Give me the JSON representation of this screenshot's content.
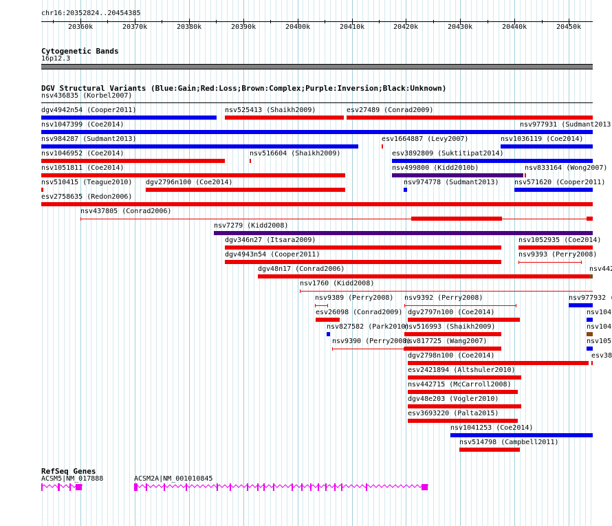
{
  "colors": {
    "gain": "#0000ee",
    "loss": "#ee0000",
    "inversion": "#4b0082",
    "complex": "#8b4513",
    "gene": "#ee00ee",
    "grid_major": "#9fd0dc",
    "grid_minor": "#d5e9ee"
  },
  "ruler": {
    "position": "chr16:20352824..20454385",
    "ticks": [
      "20360k",
      "20370k",
      "20380k",
      "20390k",
      "20400k",
      "20410k",
      "20420k",
      "20430k",
      "20440k",
      "20450k"
    ]
  },
  "cytoband": {
    "title": "Cytogenetic Bands",
    "band_label": "16p12.3"
  },
  "dgv": {
    "title": "DGV Structural Variants (Blue:Gain;Red:Loss;Brown:Complex;Purple:Inversion;Black:Unknown)",
    "features": [
      {
        "label": "nsv436835 (Korbel2007)",
        "type": "none",
        "start": 20352824,
        "end": 20454385,
        "row": 0
      },
      {
        "label": "dgv4942n54 (Cooper2011)",
        "type": "gain",
        "start": 20352824,
        "end": 20385100,
        "row": 1
      },
      {
        "label": "nsv525413 (Shaikh2009)",
        "type": "loss",
        "start": 20386650,
        "end": 20408600,
        "row": 1
      },
      {
        "label": "esv27489 (Conrad2009)",
        "type": "loss",
        "start": 20409100,
        "end": 20454385,
        "row": 1
      },
      {
        "label": "nsv1047399 (Coe2014)",
        "type": "gain",
        "start": 20352824,
        "end": 20440950,
        "row": 2
      },
      {
        "label": "nsv977931 (Sudmant2013)",
        "type": "gain",
        "start": 20440950,
        "end": 20454385,
        "row": 2
      },
      {
        "label": "nsv984287 (Sudmant2013)",
        "type": "gain",
        "start": 20352824,
        "end": 20411200,
        "row": 3
      },
      {
        "label": "esv1664887 (Levy2007)",
        "type": "loss",
        "start": 20415550,
        "end": 20415850,
        "row": 3
      },
      {
        "label": "nsv1036119 (Coe2014)",
        "type": "gain",
        "start": 20437400,
        "end": 20454385,
        "row": 3
      },
      {
        "label": "nsv1046952 (Coe2014)",
        "type": "loss",
        "start": 20352824,
        "end": 20386600,
        "row": 4
      },
      {
        "label": "nsv516604 (Shaikh2009)",
        "type": "loss",
        "start": 20391200,
        "end": 20391500,
        "row": 4
      },
      {
        "label": "esv3892809 (Suktitipat2014)",
        "type": "gain",
        "start": 20417400,
        "end": 20454385,
        "row": 4
      },
      {
        "label": "nsv1051811 (Coe2014)",
        "type": "loss",
        "start": 20352824,
        "end": 20408800,
        "row": 5
      },
      {
        "label": "nsv499800 (Kidd2010b)",
        "type": "inversion",
        "start": 20417400,
        "end": 20441600,
        "row": 5
      },
      {
        "label": "nsv833164 (Wong2007)",
        "type": "loss",
        "start": 20441800,
        "end": 20442100,
        "row": 5
      },
      {
        "label": "nsv510415 (Teague2010)",
        "type": "loss",
        "start": 20352824,
        "end": 20353200,
        "row": 6
      },
      {
        "label": "dgv2796n100 (Coe2014)",
        "type": "loss",
        "start": 20372100,
        "end": 20408800,
        "row": 6
      },
      {
        "label": "nsv974778 (Sudmant2013)",
        "type": "gain",
        "start": 20419600,
        "end": 20420200,
        "row": 6
      },
      {
        "label": "nsv571620 (Cooper2011)",
        "type": "gain",
        "start": 20439900,
        "end": 20454385,
        "row": 6
      },
      {
        "label": "esv2758635 (Redon2006)",
        "type": "loss",
        "start": 20352824,
        "end": 20454385,
        "row": 7
      }
    ],
    "long_features": [
      {
        "label": "nsv437805 (Conrad2006)",
        "type": "loss",
        "start": 20360100,
        "end": 20454385,
        "row": 8,
        "thick": [
          [
            20420900,
            20437600
          ],
          [
            20453200,
            20454385
          ]
        ],
        "label_right": "nsv104"
      },
      {
        "label": "nsv7279 (Kidd2008)",
        "type": "inversion",
        "start": 20384600,
        "end": 20454385,
        "row": 9
      },
      {
        "label": "dgv346n27 (Itsara2009)",
        "type": "loss",
        "start": 20386650,
        "end": 20437600,
        "row": 10
      },
      {
        "label": "nsv1052935 (Coe2014)",
        "type": "loss",
        "start": 20440700,
        "end": 20454385,
        "row": 10
      },
      {
        "label": "dgv4943n54 (Cooper2011)",
        "type": "loss",
        "start": 20386650,
        "end": 20437600,
        "row": 11
      },
      {
        "label": "nsv9393 (Perry2008)",
        "type": "loss",
        "start": 20440700,
        "end": 20452300,
        "row": 11,
        "thin": true
      },
      {
        "label": "dgv48n17 (Conrad2006)",
        "type": "loss",
        "start": 20392750,
        "end": 20453800,
        "row": 12
      },
      {
        "label": "nsv442",
        "type": "complex",
        "start": 20453800,
        "end": 20454385,
        "row": 12
      },
      {
        "label": "nsv1760 (Kidd2008)",
        "type": "loss",
        "start": 20400500,
        "end": 20454385,
        "row": 13,
        "thin": true
      },
      {
        "label": "nsv9389 (Perry2008)",
        "type": "loss",
        "start": 20403250,
        "end": 20405600,
        "row": 14,
        "thin": true
      },
      {
        "label": "nsv9392 (Perry2008)",
        "type": "loss",
        "start": 20419700,
        "end": 20440300,
        "row": 14,
        "thin": true
      },
      {
        "label": "nsv977932 (",
        "type": "gain",
        "start": 20449900,
        "end": 20454385,
        "row": 14
      },
      {
        "label": "esv26098 (Conrad2009)",
        "type": "loss",
        "start": 20403300,
        "end": 20407700,
        "row": 15
      },
      {
        "label": "dgv2797n100 (Coe2014)",
        "type": "loss",
        "start": 20420300,
        "end": 20440900,
        "row": 15
      },
      {
        "label": "nsv104",
        "type": "gain",
        "start": 20453300,
        "end": 20454385,
        "row": 15
      },
      {
        "label": "nsv827582 (Park2010)",
        "type": "gain",
        "start": 20405400,
        "end": 20406000,
        "row": 16
      },
      {
        "label": "nsv516993 (Shaikh2009)",
        "type": "loss",
        "start": 20419700,
        "end": 20437600,
        "row": 16
      },
      {
        "label": "nsv104",
        "type": "complex",
        "start": 20453300,
        "end": 20454385,
        "row": 16
      },
      {
        "label": "nsv9390 (Perry2008)",
        "type": "loss",
        "start": 20406400,
        "end": 20419700,
        "row": 17,
        "thin": true
      },
      {
        "label": "nsv817725 (Wang2007)",
        "type": "loss",
        "start": 20419700,
        "end": 20437600,
        "row": 17
      },
      {
        "label": "nsv105",
        "type": "gain",
        "start": 20453300,
        "end": 20454385,
        "row": 17
      },
      {
        "label": "dgv2798n100 (Coe2014)",
        "type": "loss",
        "start": 20420300,
        "end": 20453600,
        "row": 18
      },
      {
        "label": "esv38",
        "type": "loss",
        "start": 20454100,
        "end": 20454385,
        "row": 18
      },
      {
        "label": "esv2421894 (Altshuler2010)",
        "type": "loss",
        "start": 20420300,
        "end": 20441200,
        "row": 19
      },
      {
        "label": "nsv442715 (McCarroll2008)",
        "type": "loss",
        "start": 20420300,
        "end": 20440600,
        "row": 20
      },
      {
        "label": "dgv48e203 (Vogler2010)",
        "type": "loss",
        "start": 20420300,
        "end": 20441200,
        "row": 21
      },
      {
        "label": "esv3693220 (Palta2015)",
        "type": "loss",
        "start": 20420300,
        "end": 20440600,
        "row": 22
      },
      {
        "label": "nsv1041253 (Coe2014)",
        "type": "gain",
        "start": 20428200,
        "end": 20454385,
        "row": 23
      },
      {
        "label": "nsv514798 (Campbell2011)",
        "type": "loss",
        "start": 20429800,
        "end": 20441000,
        "row": 24
      }
    ]
  },
  "refseq": {
    "title": "RefSeq Genes",
    "genes": [
      {
        "label": "ACSM5|NM_017888",
        "start": 20352824,
        "end": 20360200,
        "exons": [
          [
            20352824,
            20353000
          ],
          [
            20355800,
            20356200
          ],
          [
            20358000,
            20358300
          ],
          [
            20359100,
            20360200
          ]
        ]
      },
      {
        "label": "ACSM2A|NM_001010845",
        "start": 20369900,
        "end": 20423900,
        "exons": [
          [
            20369900,
            20370500
          ],
          [
            20372100,
            20372400
          ],
          [
            20375400,
            20375700
          ],
          [
            20379400,
            20379700
          ],
          [
            20385100,
            20385400
          ],
          [
            20387500,
            20387800
          ],
          [
            20390700,
            20391000
          ],
          [
            20392600,
            20392800
          ],
          [
            20393700,
            20393900
          ],
          [
            20395500,
            20395800
          ],
          [
            20398900,
            20399200
          ],
          [
            20400700,
            20400900
          ],
          [
            20402300,
            20402600
          ],
          [
            20403700,
            20404000
          ],
          [
            20405100,
            20405400
          ],
          [
            20406700,
            20407000
          ],
          [
            20408000,
            20408300
          ],
          [
            20412600,
            20412900
          ],
          [
            20422800,
            20423900
          ]
        ]
      }
    ]
  }
}
